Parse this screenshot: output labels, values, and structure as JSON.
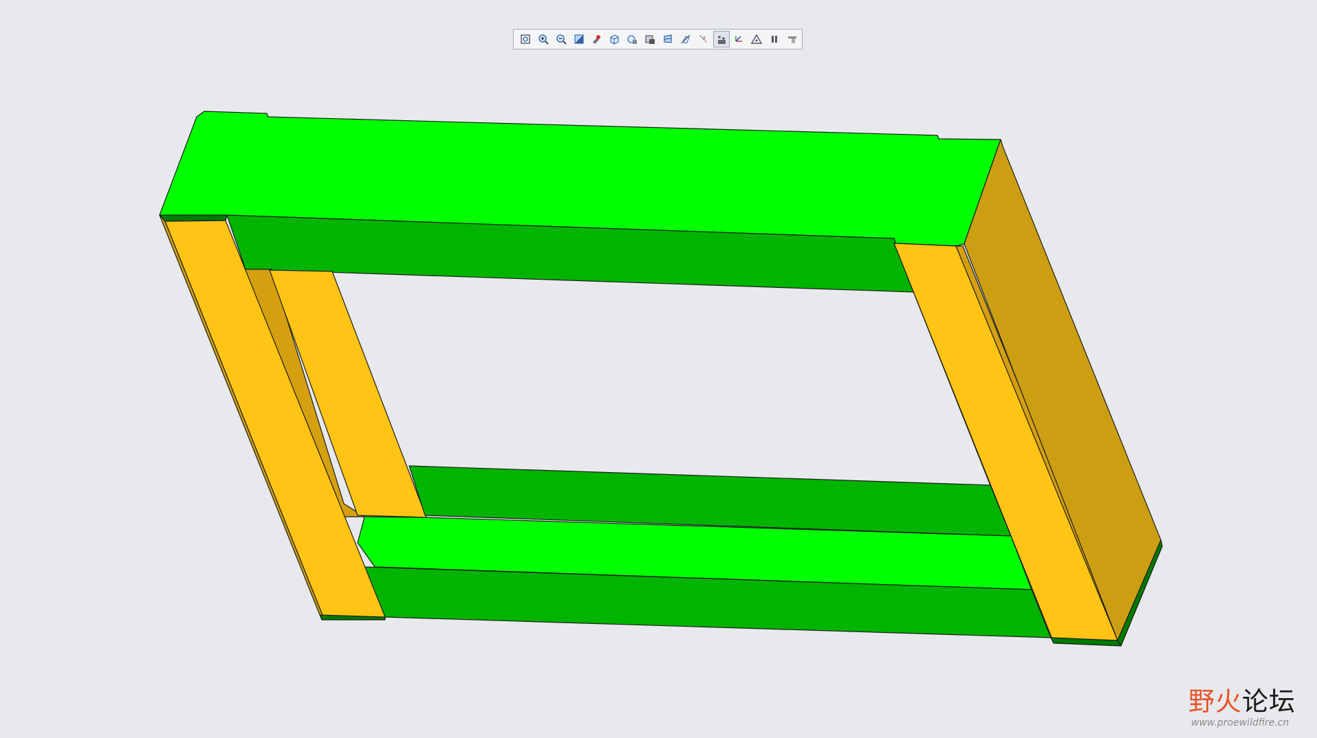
{
  "app": {
    "background": "#e8e9ec"
  },
  "toolbar": {
    "buttons": [
      {
        "id": "refit",
        "icon": "refit-icon"
      },
      {
        "id": "zoom-in",
        "icon": "zoom-in-icon"
      },
      {
        "id": "zoom-out",
        "icon": "zoom-out-icon"
      },
      {
        "id": "repaint",
        "icon": "repaint-icon"
      },
      {
        "id": "spin-center",
        "icon": "spin-center-icon"
      },
      {
        "id": "saved-views",
        "icon": "saved-orientations-icon"
      },
      {
        "id": "view-manager",
        "icon": "view-manager-icon"
      },
      {
        "id": "display-style",
        "icon": "display-style-icon"
      },
      {
        "id": "perspective",
        "icon": "perspective-icon"
      },
      {
        "id": "datum-planes",
        "icon": "datum-planes-icon"
      },
      {
        "id": "datum-axes",
        "icon": "datum-axes-icon"
      },
      {
        "id": "datum-points",
        "icon": "datum-points-icon",
        "active": true
      },
      {
        "id": "coord-systems",
        "icon": "coordinate-systems-icon"
      },
      {
        "id": "annotations",
        "icon": "annotations-icon"
      },
      {
        "id": "pause",
        "icon": "pause-icon"
      },
      {
        "id": "regenerate",
        "icon": "regenerate-icon"
      }
    ]
  },
  "model": {
    "colors": {
      "green_top": "#00ff00",
      "green_inner": "#00b400",
      "green_edge": "#007a00",
      "yellow_face": "#ffc414",
      "yellow_inner": "#d4a010",
      "yellow_side": "#cc9f12",
      "outline": "#1c1c1c"
    }
  },
  "watermark": {
    "title_part1": "野火",
    "title_part2": "论坛",
    "url": "www.proewildfire.cn",
    "color_red": "#e8552a",
    "color_dark": "#1a1a1a"
  }
}
